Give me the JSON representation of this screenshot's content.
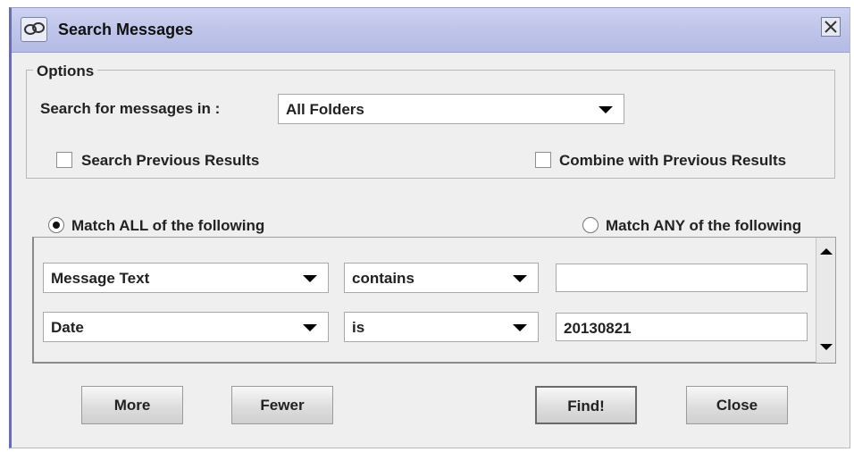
{
  "window": {
    "title": "Search Messages"
  },
  "options": {
    "legend": "Options",
    "search_in_label": "Search for messages in :",
    "folder_select": {
      "value": "All Folders"
    },
    "search_previous_results": {
      "label": "Search Previous Results",
      "checked": false
    },
    "combine_previous_results": {
      "label": "Combine with Previous Results",
      "checked": false
    }
  },
  "match": {
    "all": {
      "label": "Match ALL of the following",
      "selected": true
    },
    "any": {
      "label": "Match ANY of the following",
      "selected": false
    }
  },
  "criteria": [
    {
      "field": "Message Text",
      "operator": "contains",
      "value": ""
    },
    {
      "field": "Date",
      "operator": "is",
      "value": "20130821"
    }
  ],
  "buttons": {
    "more": "More",
    "fewer": "Fewer",
    "find": "Find!",
    "close": "Close"
  },
  "icons": {
    "app": "search-messages-icon",
    "close": "close-icon",
    "dropdown": "chevron-down-icon",
    "scroll_up": "scroll-up-arrow-icon",
    "scroll_down": "scroll-down-arrow-icon"
  }
}
